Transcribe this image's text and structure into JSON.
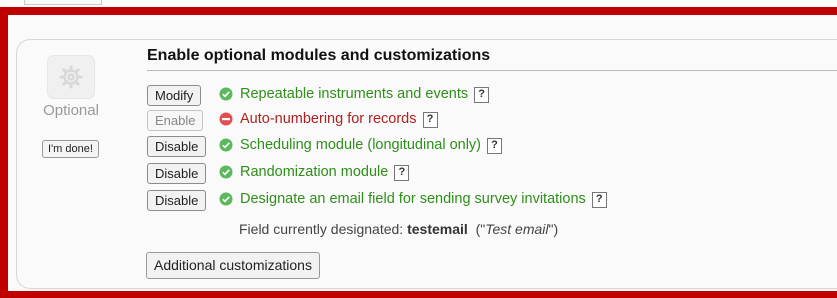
{
  "side": {
    "icon": "gear-icon",
    "label": "Optional",
    "done_button": "I'm done!"
  },
  "section": {
    "title": "Enable optional modules and customizations"
  },
  "modules": [
    {
      "button": "Modify",
      "button_enabled": true,
      "status": "enabled",
      "status_icon": "check-circle-icon",
      "label": "Repeatable instruments and events",
      "help": "?"
    },
    {
      "button": "Enable",
      "button_enabled": false,
      "status": "disabled",
      "status_icon": "minus-circle-icon",
      "label": "Auto-numbering for records",
      "help": "?"
    },
    {
      "button": "Disable",
      "button_enabled": true,
      "status": "enabled",
      "status_icon": "check-circle-icon",
      "label": "Scheduling module (longitudinal only)",
      "help": "?"
    },
    {
      "button": "Disable",
      "button_enabled": true,
      "status": "enabled",
      "status_icon": "check-circle-icon",
      "label": "Randomization module",
      "help": "?"
    },
    {
      "button": "Disable",
      "button_enabled": true,
      "status": "enabled",
      "status_icon": "check-circle-icon",
      "label": "Designate an email field for sending survey invitations",
      "help": "?"
    }
  ],
  "email_field": {
    "prefix": "Field currently designated:",
    "field_name": "testemail",
    "quote_open": "(\"",
    "field_label": "Test email",
    "quote_close": "\")"
  },
  "additional_button": "Additional customizations",
  "colors": {
    "highlight_border": "#c00000",
    "enabled_text": "#2f8f1a",
    "disabled_text": "#b02020",
    "enabled_icon": "#5cb85c",
    "disabled_icon": "#e05050"
  }
}
